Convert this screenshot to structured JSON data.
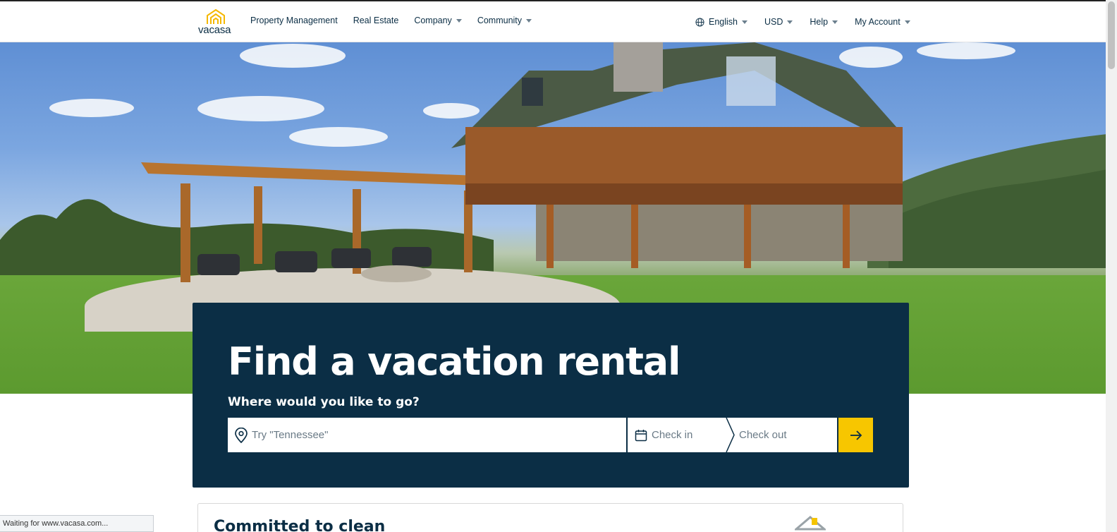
{
  "header": {
    "logo_text": "vacasa",
    "nav_left": [
      {
        "label": "Property Management",
        "has_dropdown": false
      },
      {
        "label": "Real Estate",
        "has_dropdown": false
      },
      {
        "label": "Company",
        "has_dropdown": true
      },
      {
        "label": "Community",
        "has_dropdown": true
      }
    ],
    "nav_right": {
      "language": "English",
      "currency": "USD",
      "help": "Help",
      "account": "My Account"
    }
  },
  "search": {
    "title": "Find a vacation rental",
    "subtitle": "Where would you like to go?",
    "destination_placeholder": "Try \"Tennessee\"",
    "check_in": "Check in",
    "check_out": "Check out"
  },
  "card": {
    "title": "Committed to clean"
  },
  "status_bar": "Waiting for www.vacasa.com...",
  "colors": {
    "navy": "#0b2e45",
    "accent_yellow": "#f7c600"
  }
}
